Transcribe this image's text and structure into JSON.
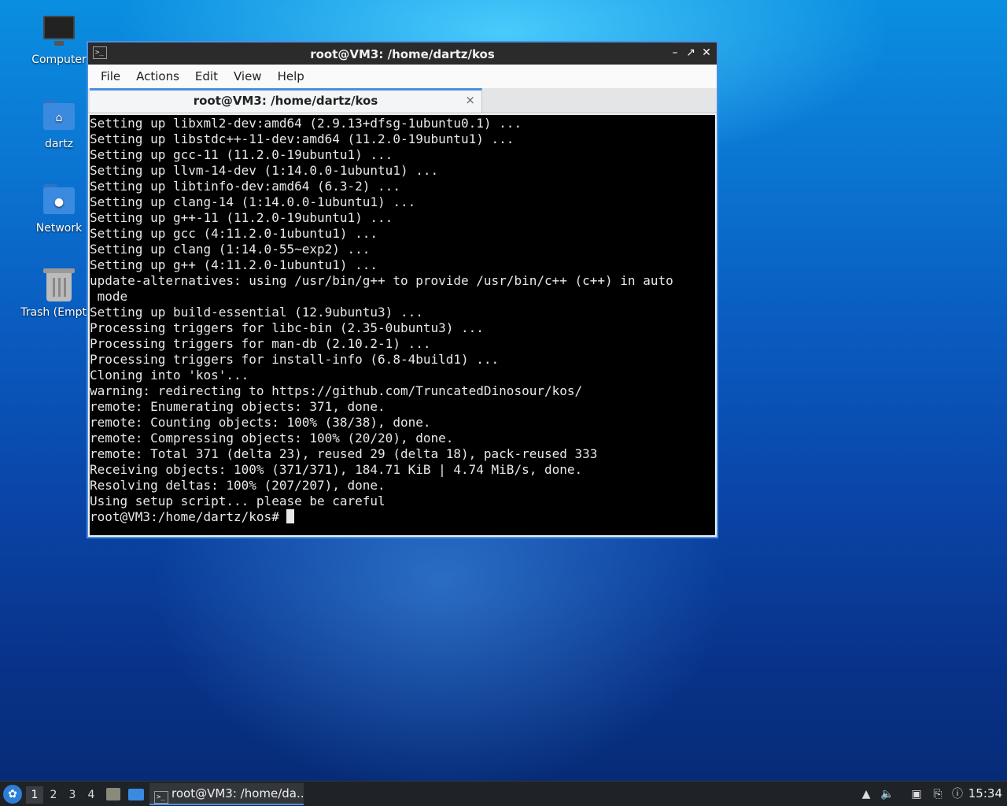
{
  "desktop": {
    "icons": [
      {
        "label": "Computer",
        "icon": "computer-icon"
      },
      {
        "label": "dartz",
        "icon": "home-folder-icon"
      },
      {
        "label": "Network",
        "icon": "network-folder-icon"
      },
      {
        "label": "Trash (Empty)",
        "icon": "trash-icon"
      }
    ]
  },
  "window": {
    "title": "root@VM3: /home/dartz/kos",
    "menu": [
      "File",
      "Actions",
      "Edit",
      "View",
      "Help"
    ],
    "tab": {
      "label": "root@VM3: /home/dartz/kos",
      "close": "×"
    },
    "terminal_lines": [
      "Setting up libxml2-dev:amd64 (2.9.13+dfsg-1ubuntu0.1) ...",
      "Setting up libstdc++-11-dev:amd64 (11.2.0-19ubuntu1) ...",
      "Setting up gcc-11 (11.2.0-19ubuntu1) ...",
      "Setting up llvm-14-dev (1:14.0.0-1ubuntu1) ...",
      "Setting up libtinfo-dev:amd64 (6.3-2) ...",
      "Setting up clang-14 (1:14.0.0-1ubuntu1) ...",
      "Setting up g++-11 (11.2.0-19ubuntu1) ...",
      "Setting up gcc (4:11.2.0-1ubuntu1) ...",
      "Setting up clang (1:14.0-55~exp2) ...",
      "Setting up g++ (4:11.2.0-1ubuntu1) ...",
      "update-alternatives: using /usr/bin/g++ to provide /usr/bin/c++ (c++) in auto",
      " mode",
      "Setting up build-essential (12.9ubuntu3) ...",
      "Processing triggers for libc-bin (2.35-0ubuntu3) ...",
      "Processing triggers for man-db (2.10.2-1) ...",
      "Processing triggers for install-info (6.8-4build1) ...",
      "Cloning into 'kos'...",
      "warning: redirecting to https://github.com/TruncatedDinosour/kos/",
      "remote: Enumerating objects: 371, done.",
      "remote: Counting objects: 100% (38/38), done.",
      "remote: Compressing objects: 100% (20/20), done.",
      "remote: Total 371 (delta 23), reused 29 (delta 18), pack-reused 333",
      "Receiving objects: 100% (371/371), 184.71 KiB | 4.74 MiB/s, done.",
      "Resolving deltas: 100% (207/207), done.",
      "Using setup script... please be careful"
    ],
    "prompt": "root@VM3:/home/dartz/kos# "
  },
  "taskbar": {
    "workspaces": [
      "1",
      "2",
      "3",
      "4"
    ],
    "active_workspace": "1",
    "task_label": "root@VM3: /home/da...",
    "clock": "15:34"
  },
  "colors": {
    "accent": "#4a90e2",
    "terminal_bg": "#000000",
    "terminal_fg": "#e8e8e8"
  }
}
